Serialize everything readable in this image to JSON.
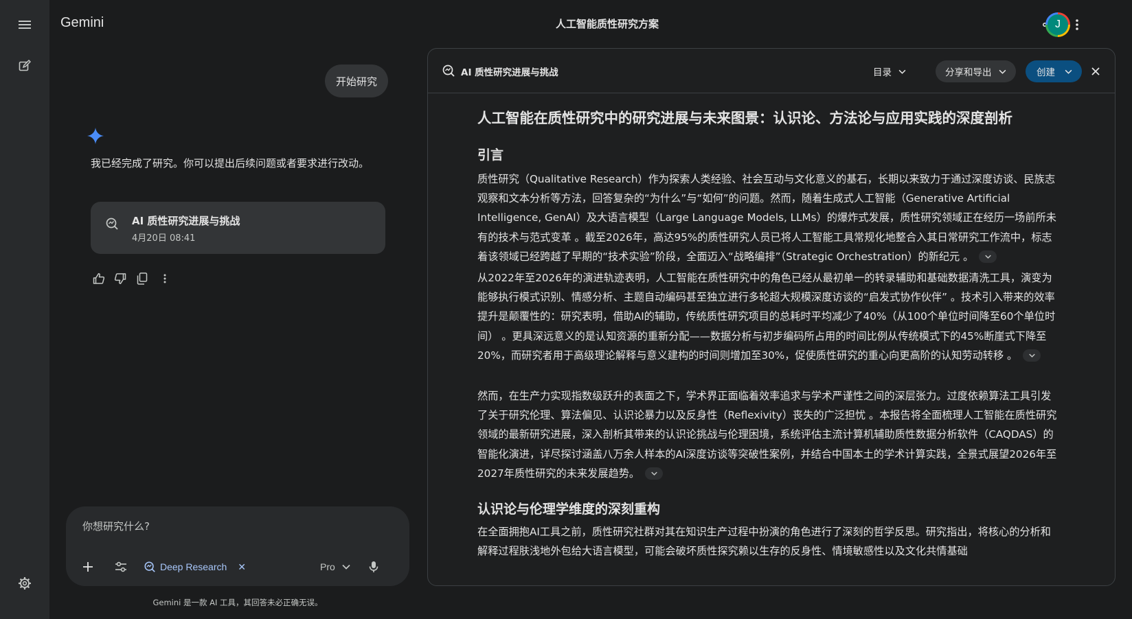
{
  "app": {
    "brand": "Gemini",
    "conversation_title": "人工智能质性研究方案"
  },
  "user": {
    "avatar_letter": "J"
  },
  "colors": {
    "accent": "#a8c7fa",
    "create_button": "#0b4f80",
    "background": "#1b1c1d",
    "panel": "#1e1f20"
  },
  "chat": {
    "user_message": "开始研究",
    "assistant_reply": "我已经完成了研究。你可以提出后续问题或者要求进行改动。",
    "research_card": {
      "title": "AI 质性研究进展与挑战",
      "date": "4月20日 08:41"
    }
  },
  "composer": {
    "placeholder": "你想研究什么?",
    "tool_chip": "Deep Research",
    "model": "Pro"
  },
  "disclaimer": "Gemini 是一款 AI 工具，其回答未必正确无误。",
  "document": {
    "header_title": "AI 质性研究进展与挑战",
    "toc_label": "目录",
    "share_label": "分享和导出",
    "create_label": "创建",
    "title": "人工智能在质性研究中的研究进展与未来图景：认识论、方法论与应用实践的深度剖析",
    "section1_heading": "引言",
    "paragraphs": [
      "质性研究（Qualitative Research）作为探索人类经验、社会互动与文化意义的基石，长期以来致力于通过深度访谈、民族志观察和文本分析等方法，回答复杂的“为什么”与“如何”的问题。然而，随着生成式人工智能（Generative Artificial Intelligence, GenAI）及大语言模型（Large Language Models, LLMs）的爆炸式发展，质性研究领域正在经历一场前所未有的技术与范式变革 。截至2026年，高达95%的质性研究人员已将人工智能工具常规化地整合入其日常研究工作流中，标志着该领域已经跨越了早期的“技术实验”阶段，全面迈入“战略编排”（Strategic Orchestration）的新纪元 。",
      "从2022年至2026年的演进轨迹表明，人工智能在质性研究中的角色已经从最初单一的转录辅助和基础数据清洗工具，演变为能够执行模式识别、情感分析、主题自动编码甚至独立进行多轮超大规模深度访谈的“启发式协作伙伴” 。技术引入带来的效率提升是颠覆性的：研究表明，借助AI的辅助，传统质性研究项目的总耗时平均减少了40%（从100个单位时间降至60个单位时间） 。更具深远意义的是认知资源的重新分配——数据分析与初步编码所占用的时间比例从传统模式下的45%断崖式下降至20%，而研究者用于高级理论解释与意义建构的时间则增加至30%，促使质性研究的重心向更高阶的认知劳动转移 。",
      "然而，在生产力实现指数级跃升的表面之下，学术界正面临着效率追求与学术严谨性之间的深层张力。过度依赖算法工具引发了关于研究伦理、算法偏见、认识论暴力以及反身性（Reflexivity）丧失的广泛担忧 。本报告将全面梳理人工智能在质性研究领域的最新研究进展，深入剖析其带来的认识论挑战与伦理困境，系统评估主流计算机辅助质性数据分析软件（CAQDAS）的智能化演进，详尽探讨涵盖八万余人样本的AI深度访谈等突破性案例，并结合中国本土的学术计算实践，全景式展望2026年至2027年质性研究的未来发展趋势。"
    ],
    "section2_heading": "认识论与伦理学维度的深刻重构",
    "section2_paragraph": "在全面拥抱AI工具之前，质性研究社群对其在知识生产过程中扮演的角色进行了深刻的哲学反思。研究指出，将核心的分析和解释过程肤浅地外包给大语言模型，可能会破坏质性探究赖以生存的反身性、情境敏感性以及文化共情基础"
  }
}
